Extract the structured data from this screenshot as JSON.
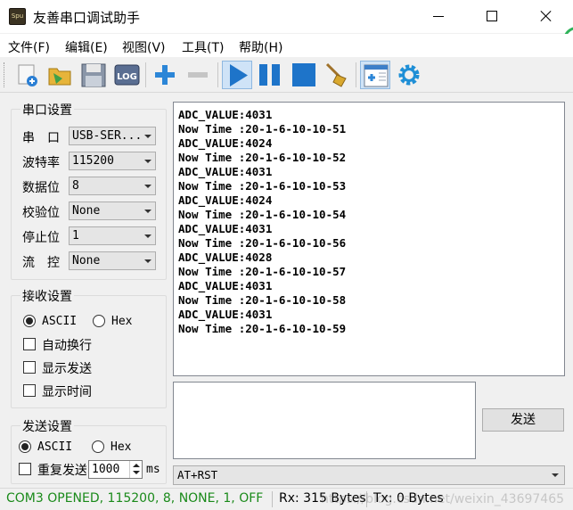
{
  "window": {
    "title": "友善串口调试助手",
    "icon_label": "Spu"
  },
  "menu": [
    {
      "label": "文件(F)"
    },
    {
      "label": "编辑(E)"
    },
    {
      "label": "视图(V)"
    },
    {
      "label": "工具(T)"
    },
    {
      "label": "帮助(H)"
    }
  ],
  "toolbar": {
    "buttons": [
      "new-session-icon",
      "open-folder-icon",
      "save-icon",
      "log-icon",
      "add-icon",
      "remove-icon",
      "play-icon",
      "pause-icon",
      "stop-icon",
      "clear-broom-icon",
      "layout-icon",
      "settings-gear-icon"
    ],
    "log_label": "LOG"
  },
  "serial_settings": {
    "title": "串口设置",
    "port": {
      "label": "串　口",
      "value": "USB-SER..."
    },
    "baud": {
      "label": "波特率",
      "value": "115200"
    },
    "data_bits": {
      "label": "数据位",
      "value": "8"
    },
    "parity": {
      "label": "校验位",
      "value": "None"
    },
    "stop_bits": {
      "label": "停止位",
      "value": "1"
    },
    "flow": {
      "label": "流　控",
      "value": "None"
    }
  },
  "receive_settings": {
    "title": "接收设置",
    "ascii_label": "ASCII",
    "hex_label": "Hex",
    "mode": "ASCII",
    "auto_wrap_label": "自动换行",
    "show_send_label": "显示发送",
    "show_time_label": "显示时间"
  },
  "send_settings": {
    "title": "发送设置",
    "ascii_label": "ASCII",
    "hex_label": "Hex",
    "mode": "ASCII",
    "repeat_label": "重复发送",
    "interval_value": "1000",
    "interval_unit": "ms"
  },
  "receive_lines": [
    "ADC_VALUE:4031",
    "Now Time :20-1-6-10-10-51",
    "ADC_VALUE:4024",
    "Now Time :20-1-6-10-10-52",
    "ADC_VALUE:4031",
    "Now Time :20-1-6-10-10-53",
    "ADC_VALUE:4024",
    "Now Time :20-1-6-10-10-54",
    "ADC_VALUE:4031",
    "Now Time :20-1-6-10-10-56",
    "ADC_VALUE:4028",
    "Now Time :20-1-6-10-10-57",
    "ADC_VALUE:4031",
    "Now Time :20-1-6-10-10-58",
    "ADC_VALUE:4031",
    "Now Time :20-1-6-10-10-59"
  ],
  "send": {
    "button_label": "发送",
    "command_value": "AT+RST",
    "text_value": ""
  },
  "status": {
    "port_status": "COM3 OPENED, 115200, 8, NONE, 1, OFF",
    "port_status_color": "#1a8a1a",
    "rx": "Rx: 315 Bytes",
    "tx": "Tx: 0 Bytes",
    "watermark": "https://blog.csdn.net/weixin_43697465"
  },
  "colors": {
    "toolbar_blue": "#1e74c9",
    "accent_green": "#2fb35a"
  }
}
